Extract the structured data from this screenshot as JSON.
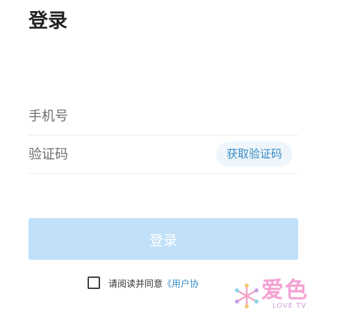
{
  "header": {
    "title": "登录"
  },
  "form": {
    "phone": {
      "placeholder": "手机号",
      "value": ""
    },
    "code": {
      "placeholder": "验证码",
      "value": ""
    },
    "get_code_label": "获取验证码",
    "login_label": "登录"
  },
  "agreement": {
    "checked": false,
    "prefix_text": "请阅读并同意",
    "link_text": "《用户协"
  },
  "watermark": {
    "text": "爱色",
    "subtext": "LOVE TV"
  },
  "colors": {
    "accent": "#3a8bc4",
    "login_button_bg": "#bfe0f8",
    "get_code_bg": "#eef6fb"
  }
}
